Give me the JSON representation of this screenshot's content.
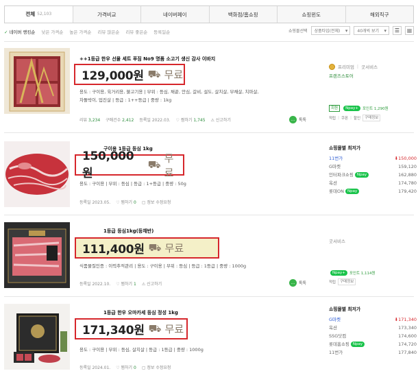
{
  "tabs": [
    {
      "label": "전체",
      "count": "52,103"
    },
    {
      "label": "가격비교",
      "count": ""
    },
    {
      "label": "네이버페이",
      "count": ""
    },
    {
      "label": "백화점/홈쇼핑",
      "count": ""
    },
    {
      "label": "쇼핑윈도",
      "count": ""
    },
    {
      "label": "해외직구",
      "count": ""
    }
  ],
  "sort": {
    "options": [
      "네이버 랭킹순",
      "낮은 가격순",
      "높은 가격순",
      "리뷰 많은순",
      "리뷰 좋은순",
      "등록일순"
    ],
    "seller_label": "쇼핑몰선택",
    "type_select": "상품타입(전체)",
    "view_select": "40개씩 보기"
  },
  "items": [
    {
      "title": "++1등급 한우 선물 세트 푸짐 No9 명품 소고기 생신 감사 이바지",
      "price": "129,000원",
      "shipping": "무료",
      "spec1": "용도 : 구이용, 육거리용, 불고기용  |  부위 : 등심, 채끝, 안심, 갈비, 설도, 살치살, 부채살, 치마살,",
      "spec2": "차돌박이, 업진살  |  등급 : 1++등급  |  중량 : 1kg",
      "meta": {
        "review_label": "리뷰",
        "review": "3,234",
        "buy_label": "구매건수",
        "buy": "2,412",
        "date": "등록일 2022.03.",
        "zzim": "찜하기",
        "zzim_count": "1,745",
        "report": "신고하기"
      },
      "talk": "톡톡",
      "seller": {
        "grade": "프리미엄",
        "service": "굿서비스",
        "store": "프랜즈스토어",
        "points": "포인트 1,290원",
        "tags": [
          "적립",
          "쿠폰",
          "할인",
          "구매정보"
        ]
      }
    },
    {
      "title": "구이용 1등급 등심 1kg",
      "price": "150,000원",
      "shipping": "무료",
      "spec1": "용도 : 구이용  |  부위 : 등심  |  등급 : 1+등급  |  중량 : 50g",
      "meta": {
        "date": "등록일 2023.05.",
        "zzim": "찜하기",
        "zzim_count": "0",
        "report": "정보 수정요청"
      },
      "right_head": "쇼핑몰별 최저가",
      "malls": [
        {
          "name": "11번가",
          "price": "150,000",
          "low": true,
          "pay": false
        },
        {
          "name": "G마켓",
          "price": "159,120",
          "low": false,
          "pay": false
        },
        {
          "name": "인터파크쇼핑",
          "price": "162,880",
          "low": false,
          "pay": true
        },
        {
          "name": "옥션",
          "price": "174,780",
          "low": false,
          "pay": false
        },
        {
          "name": "롯데ON",
          "price": "179,420",
          "low": false,
          "pay": true
        }
      ]
    },
    {
      "title": "1등급 등심1kg(등채반)",
      "price": "111,400원",
      "shipping": "무료",
      "spec1": "식품물질인증 : 이력추적관리  |  용도 : 구이용  |  부위 : 등심  |  등급 : 1등급  |  중량 : 1000g",
      "meta": {
        "date": "등록일 2022.10.",
        "zzim": "찜하기",
        "zzim_count": "1",
        "report": "신고하기"
      },
      "talk": "톡톡",
      "seller": {
        "service": "굿서비스",
        "points": "포인트 1,114원",
        "tags": [
          "적립",
          "구매정보"
        ]
      }
    },
    {
      "title": "1등급 한우 오마카세 등심 정성 1kg",
      "price": "171,340원",
      "shipping": "무료",
      "spec1": "용도 : 구이용  |  부위 : 등심, 살치살  |  등급 : 1등급  |  중량 : 1000g",
      "meta": {
        "date": "등록일 2024.01.",
        "zzim": "찜하기",
        "zzim_count": "0",
        "report": "정보 수정요청"
      },
      "right_head": "쇼핑몰별 최저가",
      "malls": [
        {
          "name": "G마켓",
          "price": "171,340",
          "low": true,
          "pay": false
        },
        {
          "name": "옥션",
          "price": "173,340",
          "low": false,
          "pay": false
        },
        {
          "name": "SSG닷컴",
          "price": "174,600",
          "low": false,
          "pay": false
        },
        {
          "name": "롯데홈쇼핑",
          "price": "174,720",
          "low": false,
          "pay": true
        },
        {
          "name": "11번가",
          "price": "177,840",
          "low": false,
          "pay": false
        }
      ]
    }
  ],
  "npay_label": "pay",
  "colors": {
    "highlight_border": "#d6262b",
    "accent_green": "#19c34a",
    "lowest_red": "#d6262b"
  }
}
